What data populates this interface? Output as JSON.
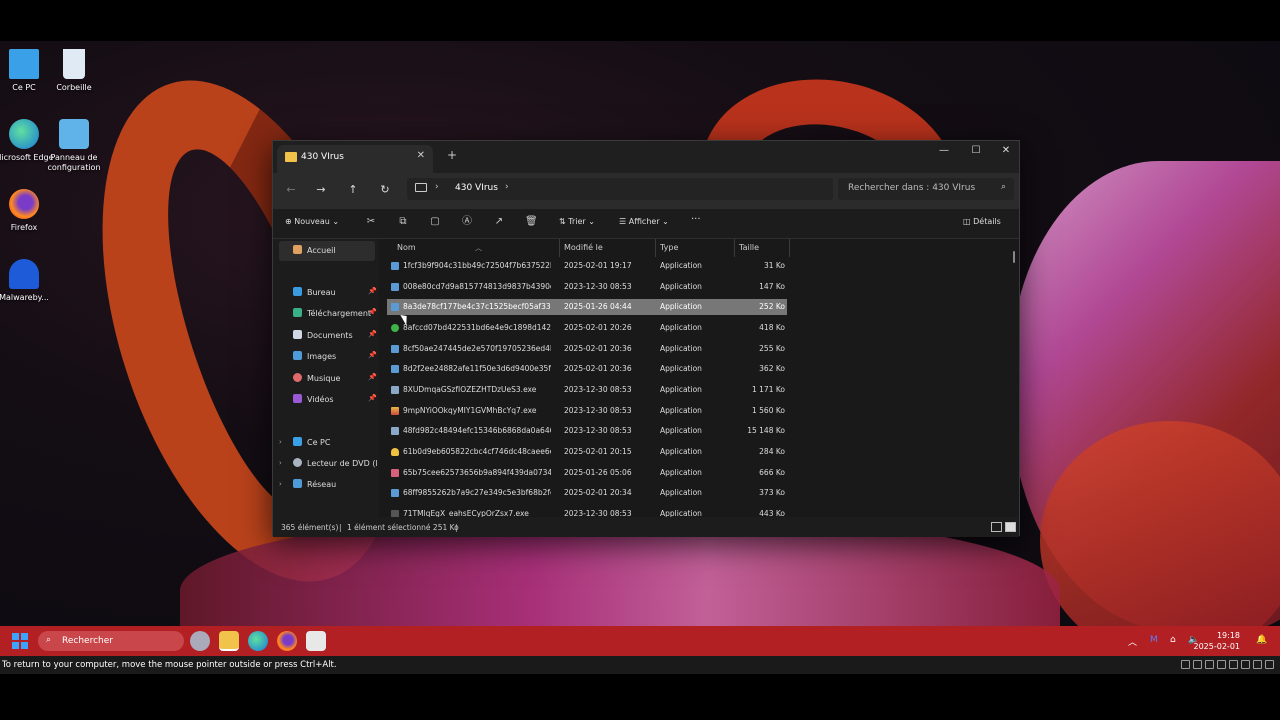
{
  "desktop": {
    "icons": [
      {
        "label": "Ce PC",
        "icon": "monitor-icon"
      },
      {
        "label": "Corbeille",
        "icon": "recycle-bin-icon"
      },
      {
        "label": "Microsoft Edge",
        "icon": "edge-icon"
      },
      {
        "label": "Panneau de configuration",
        "icon": "control-panel-icon"
      },
      {
        "label": "Firefox",
        "icon": "firefox-icon"
      },
      {
        "label": "Malwareby...",
        "icon": "malwarebytes-icon"
      }
    ]
  },
  "window": {
    "tab_title": "430 VIrus",
    "breadcrumb_folder": "430 VIrus",
    "search_placeholder": "Rechercher dans : 430 VIrus",
    "toolbar": {
      "new_label": "Nouveau",
      "sort_label": "Trier",
      "view_label": "Afficher",
      "details_label": "Détails"
    },
    "sidebar": {
      "home": "Accueil",
      "pinned": [
        "Bureau",
        "Téléchargement",
        "Documents",
        "Images",
        "Musique",
        "Vidéos"
      ],
      "drives": [
        "Ce PC",
        "Lecteur de DVD (D:)",
        "Réseau"
      ]
    },
    "columns": {
      "name": "Nom",
      "modified": "Modifié le",
      "type": "Type",
      "size": "Taille"
    },
    "files": [
      {
        "name": "1fcf3b9f904c31bb49c72504f7b637522b68...",
        "modified": "2025-02-01 19:17",
        "type": "Application",
        "size": "31 Ko"
      },
      {
        "name": "008e80cd7d9a815774813d9837b4390d7f9...",
        "modified": "2023-12-30 08:53",
        "type": "Application",
        "size": "147 Ko"
      },
      {
        "name": "8a3de78cf177be4c37c1525becf05af336c1...",
        "modified": "2025-01-26 04:44",
        "type": "Application",
        "size": "252 Ko"
      },
      {
        "name": "8afccd07bd422531bd6e4e9c1898d142851...",
        "modified": "2025-02-01 20:26",
        "type": "Application",
        "size": "418 Ko"
      },
      {
        "name": "8cf50ae247445de2e570f19705236ed4b1e1...",
        "modified": "2025-02-01 20:36",
        "type": "Application",
        "size": "255 Ko"
      },
      {
        "name": "8d2f2ee24882afe11f50e3d6d9400e35fa667...",
        "modified": "2025-02-01 20:36",
        "type": "Application",
        "size": "362 Ko"
      },
      {
        "name": "8XUDmqaGSzfIOZEZHTDzUeS3.exe",
        "modified": "2023-12-30 08:53",
        "type": "Application",
        "size": "1 171 Ko"
      },
      {
        "name": "9mpNYiOOkqyMIY1GVMhBcYq7.exe",
        "modified": "2023-12-30 08:53",
        "type": "Application",
        "size": "1 560 Ko"
      },
      {
        "name": "48fd982c48494efc15346b6868da0a646612...",
        "modified": "2023-12-30 08:53",
        "type": "Application",
        "size": "15 148 Ko"
      },
      {
        "name": "61b0d9eb605822cbc4cf746dc48caee6eaa...",
        "modified": "2025-02-01 20:15",
        "type": "Application",
        "size": "284 Ko"
      },
      {
        "name": "65b75cee62573656b9a894f439da073433c7...",
        "modified": "2025-01-26 05:06",
        "type": "Application",
        "size": "666 Ko"
      },
      {
        "name": "68ff9855262b7a9c27e349c5e3bf68b2fc9f9...",
        "modified": "2025-02-01 20:34",
        "type": "Application",
        "size": "373 Ko"
      },
      {
        "name": "71TMlqEgX_eahsECypOrZsx7.exe",
        "modified": "2023-12-30 08:53",
        "type": "Application",
        "size": "443 Ko"
      }
    ],
    "selected_row_index": 2,
    "status": {
      "count": "365 élément(s)",
      "selection": "1 élément sélectionné  251 Ko"
    }
  },
  "taskbar": {
    "search_label": "Rechercher",
    "time": "19:18",
    "date": "2025-02-01"
  },
  "vm_notice": "To return to your computer, move the mouse pointer outside or press Ctrl+Alt.",
  "colors": {
    "taskbar": "#b32024",
    "selection": "#777777",
    "accent": "#3ea3ff"
  }
}
